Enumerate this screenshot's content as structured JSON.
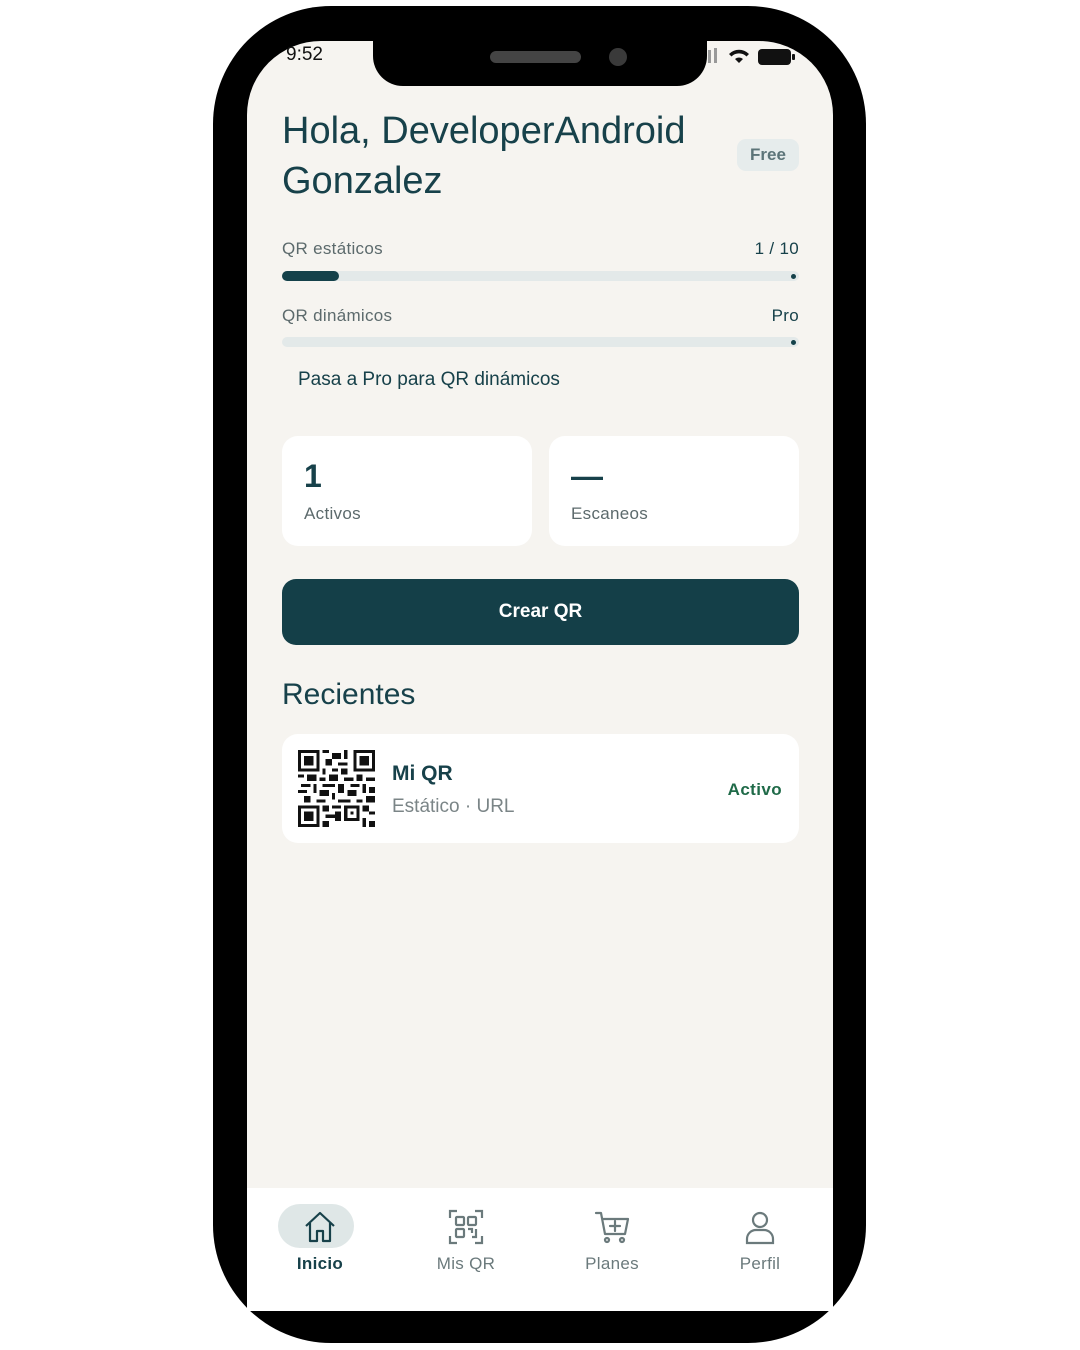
{
  "status_bar": {
    "time": "9:52"
  },
  "header": {
    "greeting": "Hola, DeveloperAndroid Gonzalez",
    "plan_badge": "Free"
  },
  "quota": {
    "static": {
      "label": "QR estáticos",
      "value": "1 / 10",
      "progress": 0.1
    },
    "dynamic": {
      "label": "QR dinámicos",
      "value": "Pro",
      "progress": 0
    }
  },
  "promo_text": "Pasa a Pro para QR dinámicos",
  "stats": [
    {
      "value": "1",
      "label": "Activos"
    },
    {
      "value": "—",
      "label": "Escaneos"
    }
  ],
  "create_button": "Crear QR",
  "recent": {
    "title": "Recientes",
    "items": [
      {
        "title": "Mi QR",
        "subtitle": "Estático · URL",
        "status": "Activo"
      }
    ]
  },
  "nav": {
    "items": [
      {
        "label": "Inicio",
        "icon": "home-icon",
        "active": true
      },
      {
        "label": "Mis QR",
        "icon": "qr-code-icon",
        "active": false
      },
      {
        "label": "Planes",
        "icon": "cart-plus-icon",
        "active": false
      },
      {
        "label": "Perfil",
        "icon": "user-icon",
        "active": false
      }
    ]
  },
  "colors": {
    "primary": "#143f48",
    "background": "#f6f4f0",
    "success": "#1f6a48"
  }
}
